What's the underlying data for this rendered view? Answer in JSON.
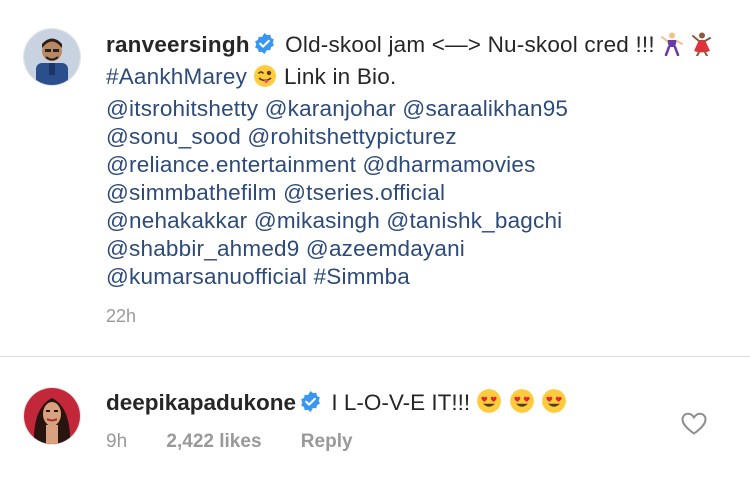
{
  "post": {
    "username": "ranveersingh",
    "caption_intro": "Old-skool jam <—> Nu-skool cred !!!",
    "hashtag_1": "#AankhMarey",
    "link_text": "Link in Bio.",
    "mentions": [
      "@itsrohitshetty",
      "@karanjohar",
      "@saraalikhan95",
      "@sonu_sood",
      "@rohitshettypicturez",
      "@reliance.entertainment",
      "@dharmamovies",
      "@simmbathefilm",
      "@tseries.official",
      "@nehakakkar",
      "@mikasingh",
      "@tanishk_bagchi",
      "@shabbir_ahmed9",
      "@azeemdayani",
      "@kumarsanuofficial"
    ],
    "hashtag_2": "#Simmba",
    "time": "22h"
  },
  "comment": {
    "username": "deepikapadukone",
    "text": "I L-O-V-E IT!!!",
    "time": "9h",
    "likes": "2,422 likes",
    "reply_label": "Reply"
  },
  "colors": {
    "link": "#2d4b7a",
    "muted": "#999999",
    "verified": "#3897f0",
    "divider": "#dbdbdb"
  },
  "icons": [
    "verified-badge-icon",
    "dancer-emoji-icon",
    "heart-eyes-emoji-icon",
    "wink-tongue-emoji-icon",
    "heart-outline-icon"
  ]
}
